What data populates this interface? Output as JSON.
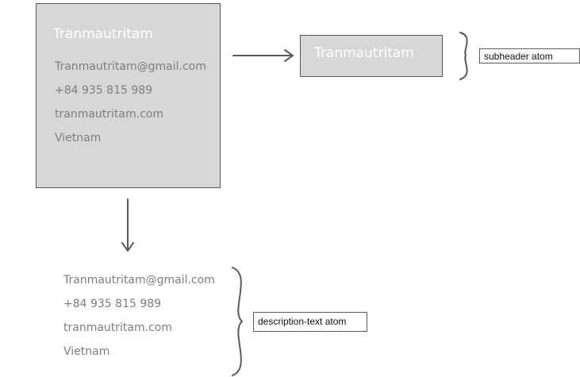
{
  "profile_card": {
    "name": "Tranmautritam",
    "email": "Tranmautritam@gmail.com",
    "phone": "+84 935 815 989",
    "website": "tranmautritam.com",
    "country": "Vietnam"
  },
  "subheader_example": {
    "text": "Tranmautritam",
    "annotation": "subheader atom"
  },
  "description_example": {
    "lines": [
      "Tranmautritam@gmail.com",
      "+84 935 815 989",
      "tranmautritam.com",
      "Vietnam"
    ],
    "annotation": "description-text atom"
  },
  "colors": {
    "card_fill": "#d7d7d7",
    "stroke": "#5a5a5a",
    "title_text": "#ffffff",
    "body_text": "#7e7e7e"
  }
}
